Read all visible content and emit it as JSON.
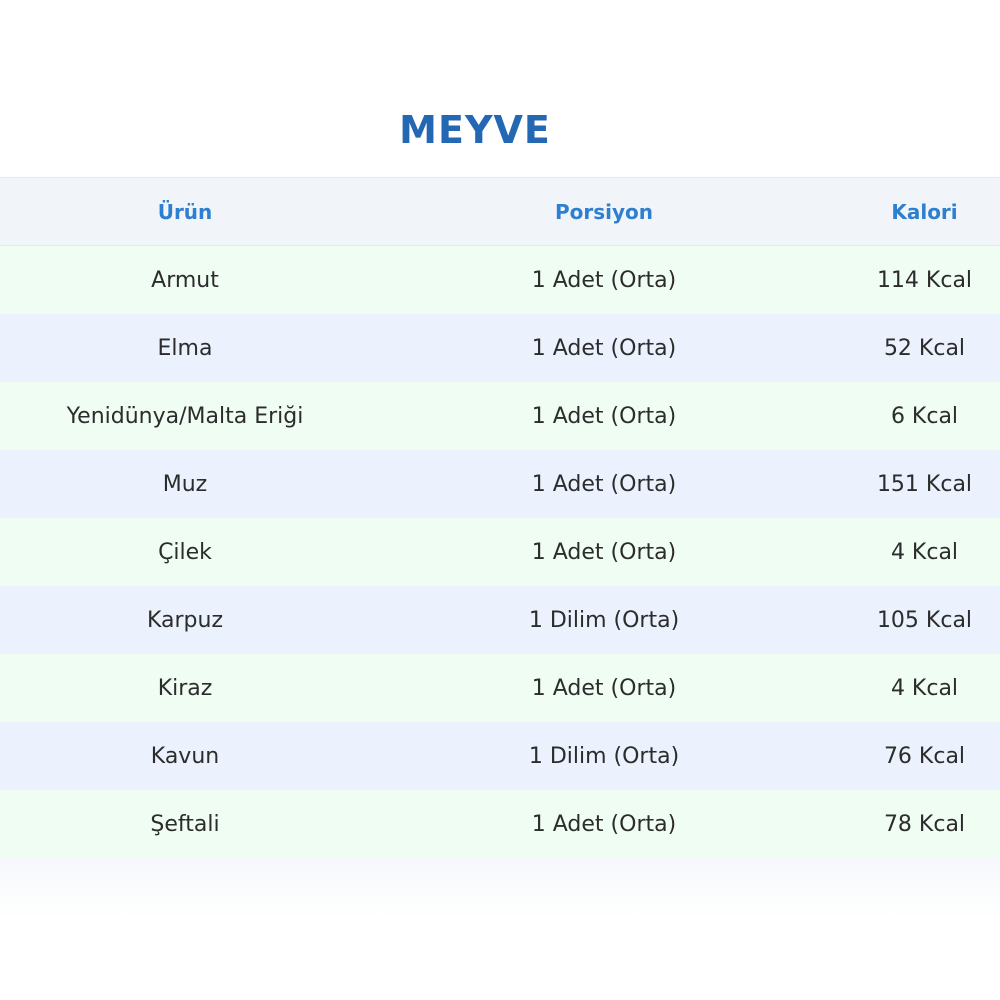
{
  "title": "MEYVE",
  "table": {
    "headers": [
      "Ürün",
      "Porsiyon",
      "Kalori"
    ],
    "rows": [
      [
        "Armut",
        "1 Adet (Orta)",
        "114 Kcal"
      ],
      [
        "Elma",
        "1 Adet (Orta)",
        "52 Kcal"
      ],
      [
        "Yenidünya/Malta Eriği",
        "1 Adet (Orta)",
        "6 Kcal"
      ],
      [
        "Muz",
        "1 Adet (Orta)",
        "151 Kcal"
      ],
      [
        "Çilek",
        "1 Adet (Orta)",
        "4 Kcal"
      ],
      [
        "Karpuz",
        "1 Dilim (Orta)",
        "105 Kcal"
      ],
      [
        "Kiraz",
        "1 Adet (Orta)",
        "4 Kcal"
      ],
      [
        "Kavun",
        "1 Dilim (Orta)",
        "76 Kcal"
      ],
      [
        "Şeftali",
        "1 Adet (Orta)",
        "78 Kcal"
      ]
    ]
  },
  "colors": {
    "title": "#2468b4",
    "header_text": "#2e7fcf",
    "header_bg": "#f1f5f9",
    "row_green": "#f0fdf3",
    "row_blue": "#ebf2fe"
  }
}
